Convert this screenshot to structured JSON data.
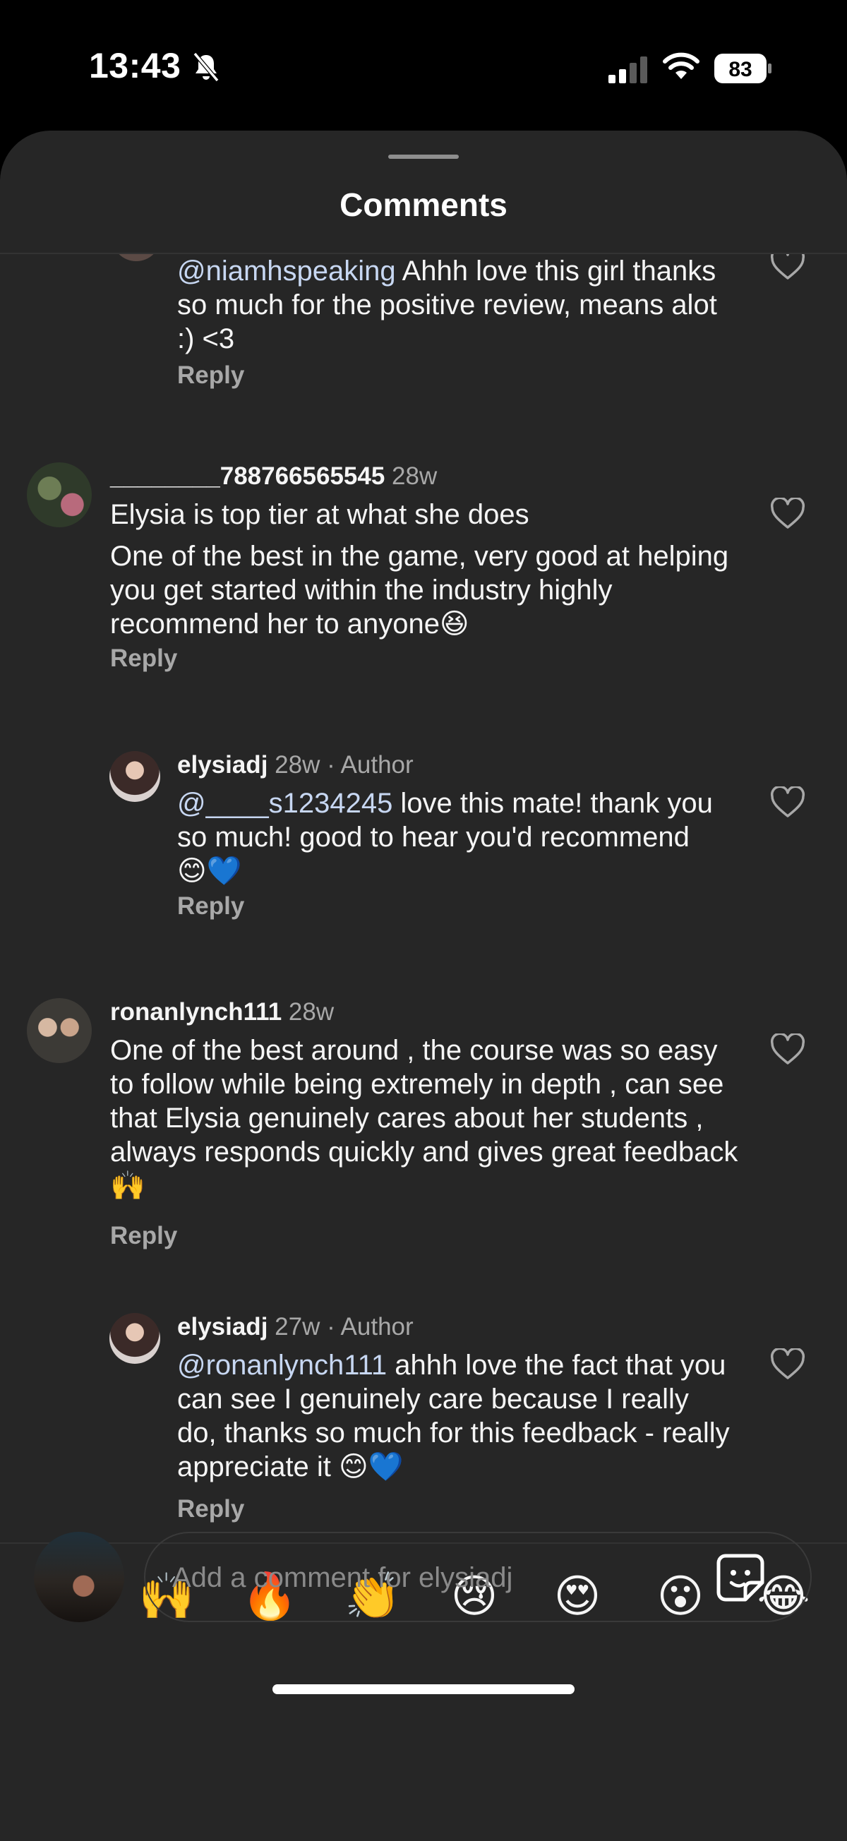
{
  "status_bar": {
    "time": "13:43",
    "battery": "83"
  },
  "sheet": {
    "title": "Comments"
  },
  "comments": [
    {
      "username": "",
      "time": "",
      "tag": "",
      "mention": "@niamhspeaking",
      "text": " Ahhh love this girl thanks so much for the positive review, means alot :) <3",
      "reply_label": "Reply"
    },
    {
      "username": "________788766565545",
      "time": "28w",
      "tag": "",
      "mention": "",
      "text": "Elysia is top tier at what she does",
      "text2": "One of the best in the game, very good at helping you get started within the industry highly recommend her to anyone😆",
      "reply_label": "Reply"
    },
    {
      "username": "elysiadj",
      "time": "28w",
      "tag": "· Author",
      "mention": "@____s1234245",
      "text": " love this mate! thank you so much! good to hear you'd recommend 😊💙",
      "reply_label": "Reply"
    },
    {
      "username": "ronanlynch111",
      "time": "28w",
      "tag": "",
      "mention": "",
      "text": "One of the best around , the course was so easy to follow while being extremely in depth , can see that Elysia genuinely cares about her students , always responds quickly and gives great feedback 🙌",
      "reply_label": "Reply"
    },
    {
      "username": "elysiadj",
      "time": "27w",
      "tag": "· Author",
      "mention": "@ronanlynch111",
      "text": " ahhh love the fact that you can see I genuinely care because I really do, thanks so much for this feedback - really appreciate it 😊💙",
      "reply_label": "Reply"
    }
  ],
  "emoji_bar": [
    "❤️",
    "🙌",
    "🔥",
    "👏",
    "😢",
    "😍",
    "😮",
    "😂"
  ],
  "composer": {
    "placeholder": "Add a comment for elysiadj"
  }
}
